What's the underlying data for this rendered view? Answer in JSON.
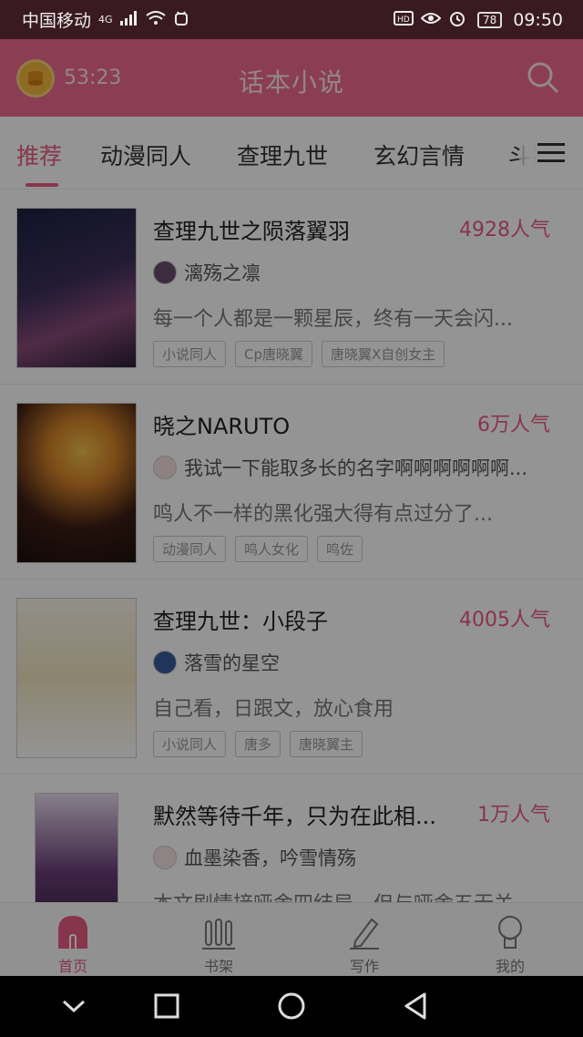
{
  "status_bar": {
    "carrier": "中国移动",
    "network": "4G",
    "battery": "78",
    "time": "09:50"
  },
  "header": {
    "timer": "53:23",
    "title": "话本小说"
  },
  "tabs": [
    "推荐",
    "动漫同人",
    "查理九世",
    "玄幻言情",
    "斗罗"
  ],
  "books": [
    {
      "title": "查理九世之陨落翼羽",
      "popularity": "4928人气",
      "author": "漓殇之凛",
      "description": "每一个人都是一颗星辰，终有一天会闪...",
      "tags": [
        "小说同人",
        "Cp唐晓翼",
        "唐晓翼X自创女主"
      ]
    },
    {
      "title": "晓之NARUTO",
      "popularity": "6万人气",
      "author": "我试一下能取多长的名字啊啊啊啊啊啊...",
      "description": "鸣人不一样的黑化强大得有点过分了...",
      "tags": [
        "动漫同人",
        "鸣人女化",
        "鸣佐"
      ]
    },
    {
      "title": "查理九世：小段子",
      "popularity": "4005人气",
      "author": "落雪的星空",
      "description": "自己看，日跟文，放心食用",
      "tags": [
        "小说同人",
        "唐多",
        "唐晓翼主"
      ]
    },
    {
      "title": "默然等待千年，只为在此相...",
      "popularity": "1万人气",
      "author": "血墨染香，吟雪情殇",
      "description": "本文剧情接哑舍四结局，但与哑舍五无关",
      "tags": []
    }
  ],
  "bottom_nav": [
    {
      "label": "首页",
      "icon": "home-icon",
      "active": true
    },
    {
      "label": "书架",
      "icon": "bookshelf-icon",
      "active": false
    },
    {
      "label": "写作",
      "icon": "pen-icon",
      "active": false
    },
    {
      "label": "我的",
      "icon": "profile-icon",
      "active": false
    }
  ],
  "colors": {
    "accent": "#e85c84",
    "header_bg": "#f06b8f",
    "status_bar_bg": "#3a1a22"
  }
}
